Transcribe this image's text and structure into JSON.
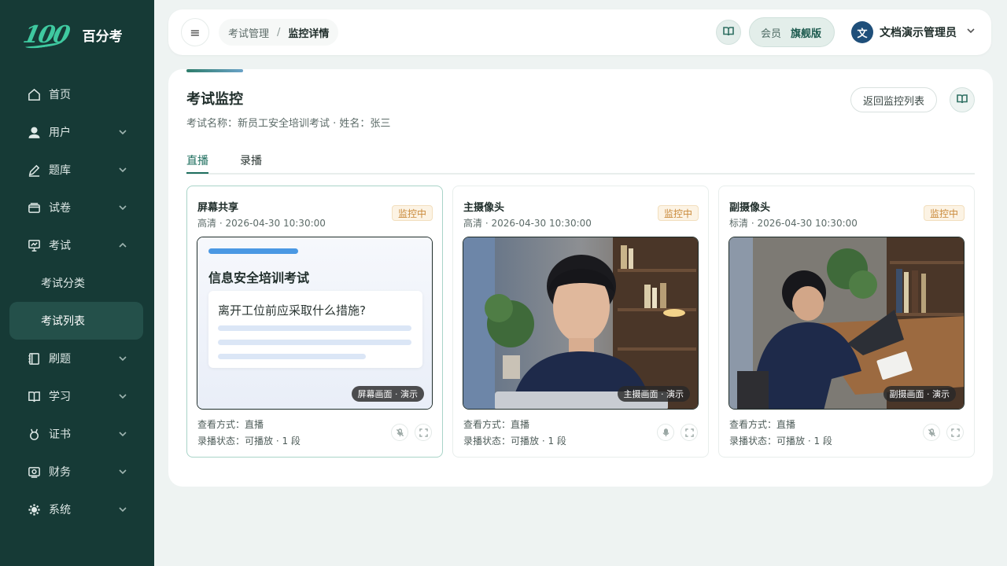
{
  "brand": {
    "logo": "100",
    "name": "百分考"
  },
  "sidebar": {
    "items": [
      {
        "label": "首页"
      },
      {
        "label": "用户"
      },
      {
        "label": "题库"
      },
      {
        "label": "试卷"
      },
      {
        "label": "考试"
      },
      {
        "label": "考试分类"
      },
      {
        "label": "考试列表"
      },
      {
        "label": "刷题"
      },
      {
        "label": "学习"
      },
      {
        "label": "证书"
      },
      {
        "label": "财务"
      },
      {
        "label": "系统"
      }
    ]
  },
  "topbar": {
    "breadcrumb": [
      "考试管理",
      "监控详情"
    ],
    "breadcrumb_sep": "/",
    "member_label": "会员",
    "member_tier": "旗舰版",
    "avatar_text": "文",
    "user_name": "文档演示管理员"
  },
  "main": {
    "title": "考试监控",
    "subtitle": "考试名称：新员工安全培训考试 · 姓名：张三",
    "back_button": "返回监控列表",
    "tabs": [
      {
        "label": "直播"
      },
      {
        "label": "录播"
      }
    ]
  },
  "cards": [
    {
      "title": "屏幕共享",
      "meta": "高清 · 2026-04-30 10:30:00",
      "badge": "监控中",
      "frame_label": "屏幕画面 · 演示",
      "view_mode": "查看方式：直播",
      "record_status": "录播状态：可播放 · 1 段",
      "screen_heading": "信息安全培训考试",
      "screen_question": "离开工位前应采取什么措施?"
    },
    {
      "title": "主摄像头",
      "meta": "高清 · 2026-04-30 10:30:00",
      "badge": "监控中",
      "frame_label": "主摄画面 · 演示",
      "view_mode": "查看方式：直播",
      "record_status": "录播状态：可播放 · 1 段"
    },
    {
      "title": "副摄像头",
      "meta": "标清 · 2026-04-30 10:30:00",
      "badge": "监控中",
      "frame_label": "副摄画面 · 演示",
      "view_mode": "查看方式：直播",
      "record_status": "录播状态：可播放 · 1 段"
    }
  ],
  "colors": {
    "sidebar_bg": "#163a36",
    "accent": "#1f6f5f",
    "badge": "#c9893a"
  }
}
